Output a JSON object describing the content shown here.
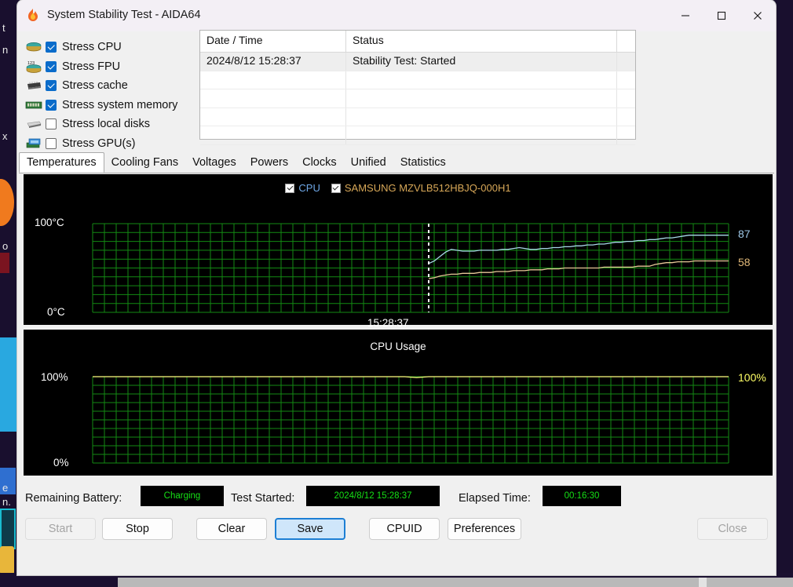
{
  "window": {
    "title": "System Stability Test - AIDA64",
    "app_icon": "flame-icon",
    "minimize_label": "—",
    "maximize_label": "❑",
    "close_label": "✕"
  },
  "options": [
    {
      "label": "Stress CPU",
      "checked": true,
      "icon": "cpu-chip-icon"
    },
    {
      "label": "Stress FPU",
      "checked": true,
      "icon": "fpu-chip-icon"
    },
    {
      "label": "Stress cache",
      "checked": true,
      "icon": "cache-chip-icon"
    },
    {
      "label": "Stress system memory",
      "checked": true,
      "icon": "memory-stick-icon"
    },
    {
      "label": "Stress local disks",
      "checked": false,
      "icon": "hard-disk-icon"
    },
    {
      "label": "Stress GPU(s)",
      "checked": false,
      "icon": "gpu-card-icon"
    }
  ],
  "log": {
    "columns": [
      "Date / Time",
      "Status",
      ""
    ],
    "rows": [
      {
        "datetime": "2024/8/12 15:28:37",
        "status": "Stability Test: Started",
        "extra": ""
      }
    ],
    "empty_rows": 4
  },
  "tabs": [
    {
      "label": "Temperatures",
      "active": true
    },
    {
      "label": "Cooling Fans",
      "active": false
    },
    {
      "label": "Voltages",
      "active": false
    },
    {
      "label": "Powers",
      "active": false
    },
    {
      "label": "Clocks",
      "active": false
    },
    {
      "label": "Unified",
      "active": false
    },
    {
      "label": "Statistics",
      "active": false
    }
  ],
  "chart_data": [
    {
      "type": "line",
      "name": "temperature-graph",
      "title": "",
      "ylabel_top": "100°C",
      "ylabel_bottom": "0°C",
      "ylim": [
        0,
        100
      ],
      "grid": true,
      "xlabel": "",
      "time_marker_label": "15:28:37",
      "legend_position": "top-center",
      "series": [
        {
          "name": "CPU",
          "color": "#a8d8e8",
          "current_value": "87",
          "value_label_color": "#9ec8e8",
          "values": [
            55,
            58,
            63,
            68,
            71,
            70,
            69,
            69,
            69,
            70,
            70,
            70,
            70,
            71,
            71,
            72,
            73,
            72,
            71,
            71,
            72,
            72,
            73,
            73,
            74,
            74,
            75,
            75,
            76,
            76,
            77,
            77,
            78,
            79,
            79,
            80,
            80,
            81,
            81,
            82,
            82,
            83,
            84,
            84,
            85,
            86,
            87,
            87,
            87,
            87,
            87,
            87,
            87,
            87
          ]
        },
        {
          "name": "SAMSUNG MZVLB512HBJQ-000H1",
          "color": "#e8c898",
          "current_value": "58",
          "value_label_color": "#e0b878",
          "values": [
            38,
            39,
            41,
            42,
            43,
            43,
            44,
            44,
            44,
            45,
            45,
            45,
            46,
            46,
            46,
            47,
            47,
            47,
            48,
            48,
            48,
            49,
            49,
            49,
            50,
            50,
            50,
            50,
            50,
            50,
            50,
            51,
            51,
            51,
            51,
            51,
            51,
            52,
            52,
            52,
            54,
            55,
            56,
            56,
            57,
            57,
            57,
            58,
            58,
            58,
            58,
            58,
            58,
            58
          ]
        }
      ]
    },
    {
      "type": "line",
      "name": "cpu-usage-graph",
      "title": "CPU Usage",
      "ylabel_top": "100%",
      "ylabel_bottom": "0%",
      "ylim": [
        0,
        100
      ],
      "grid": true,
      "series": [
        {
          "name": "CPU Usage",
          "color": "#ffff80",
          "current_value": "100%",
          "value_label_color": "#ffff66",
          "values": [
            100,
            100,
            100,
            100,
            100,
            100,
            100,
            100,
            100,
            100,
            100,
            100,
            100,
            100,
            100,
            100,
            100,
            100,
            100,
            100,
            100,
            100,
            100,
            100,
            100,
            100,
            100,
            99,
            100,
            100,
            100,
            100,
            100,
            100,
            100,
            100,
            100,
            100,
            100,
            100,
            100,
            100,
            100,
            100,
            100,
            100,
            100,
            100,
            100,
            100,
            100,
            100,
            100,
            100
          ]
        }
      ]
    }
  ],
  "status": {
    "battery_label": "Remaining Battery:",
    "battery_value": "Charging",
    "test_started_label": "Test Started:",
    "test_started_value": "2024/8/12 15:28:37",
    "elapsed_label": "Elapsed Time:",
    "elapsed_value": "00:16:30",
    "field_text_color": "#15e015"
  },
  "buttons": [
    {
      "label": "Start",
      "state": "disabled"
    },
    {
      "label": "Stop",
      "state": "normal"
    },
    {
      "label": "Clear",
      "state": "normal"
    },
    {
      "label": "Save",
      "state": "focused"
    },
    {
      "label": "CPUID",
      "state": "normal"
    },
    {
      "label": "Preferences",
      "state": "normal"
    },
    {
      "label": "Close",
      "state": "disabled"
    }
  ],
  "desktop": {
    "fragments": [
      "t",
      "n",
      "x",
      "o",
      "e",
      "n."
    ]
  }
}
